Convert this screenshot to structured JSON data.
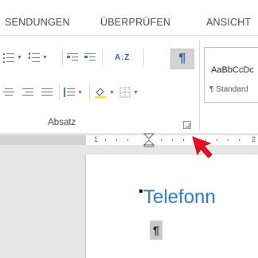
{
  "tabs": [
    "SENDUNGEN",
    "ÜBERPRÜFEN",
    "ANSICHT"
  ],
  "ribbon": {
    "group_label": "Absatz",
    "pilcrow": "¶",
    "sort_label": "A↓Z",
    "styles": {
      "sample": "AaBbCcDc",
      "name": "¶ Standard"
    }
  },
  "ruler": {
    "numbers": [
      "1",
      "2"
    ]
  },
  "document": {
    "heading": "Telefonn",
    "paragraph_mark": "¶"
  },
  "icons": [
    "bullets-icon",
    "numbering-icon",
    "multilevel-list-icon",
    "decrease-indent-icon",
    "increase-indent-icon",
    "sort-icon",
    "show-formatting-icon",
    "align-left-icon",
    "center-icon",
    "align-right-icon",
    "justify-icon",
    "line-spacing-icon",
    "shading-icon",
    "borders-icon",
    "dialog-launcher-icon",
    "mouse-cursor-icon",
    "indent-marker-icon"
  ],
  "colors": {
    "heading": "#2e74b5",
    "accent": "#2b579a",
    "cursor": "#e81123"
  }
}
